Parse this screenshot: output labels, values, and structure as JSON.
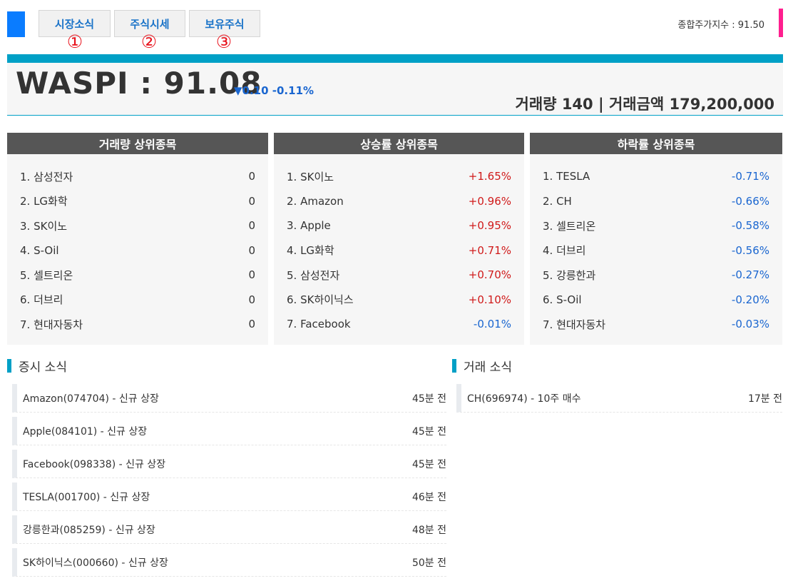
{
  "tabs": [
    {
      "label": "시장소식",
      "num": "①"
    },
    {
      "label": "주식시세",
      "num": "②"
    },
    {
      "label": "보유주식",
      "num": "③"
    }
  ],
  "composite_index": "종합주가지수 : 91.50",
  "summary": {
    "waspi": "WASPI : 91.08",
    "change": "▼0.10 -0.11%",
    "volume_label": "거래량 140 | 거래금액 179,200,000"
  },
  "panels": {
    "volume": {
      "title": "거래량 상위종목",
      "items": [
        {
          "name": "1. 삼성전자",
          "value": "0"
        },
        {
          "name": "2. LG화학",
          "value": "0"
        },
        {
          "name": "3. SK이노",
          "value": "0"
        },
        {
          "name": "4. S-Oil",
          "value": "0"
        },
        {
          "name": "5. 셀트리온",
          "value": "0"
        },
        {
          "name": "6. 더브리",
          "value": "0"
        },
        {
          "name": "7. 현대자동차",
          "value": "0"
        }
      ]
    },
    "rise": {
      "title": "상승률 상위종목",
      "items": [
        {
          "name": "1. SK이노",
          "value": "+1.65%"
        },
        {
          "name": "2. Amazon",
          "value": "+0.96%"
        },
        {
          "name": "3. Apple",
          "value": "+0.95%"
        },
        {
          "name": "4. LG화학",
          "value": "+0.71%"
        },
        {
          "name": "5. 삼성전자",
          "value": "+0.70%"
        },
        {
          "name": "6. SK하이닉스",
          "value": "+0.10%"
        },
        {
          "name": "7. Facebook",
          "value": "-0.01%"
        }
      ]
    },
    "fall": {
      "title": "하락률 상위종목",
      "items": [
        {
          "name": "1. TESLA",
          "value": "-0.71%"
        },
        {
          "name": "2. CH",
          "value": "-0.66%"
        },
        {
          "name": "3. 셀트리온",
          "value": "-0.58%"
        },
        {
          "name": "4. 더브리",
          "value": "-0.56%"
        },
        {
          "name": "5. 강릉한과",
          "value": "-0.27%"
        },
        {
          "name": "6. S-Oil",
          "value": "-0.20%"
        },
        {
          "name": "7. 현대자동차",
          "value": "-0.03%"
        }
      ]
    }
  },
  "market_news": {
    "title": "증시 소식",
    "items": [
      {
        "text": "Amazon(074704) - 신규 상장",
        "time": "45분 전"
      },
      {
        "text": "Apple(084101) - 신규 상장",
        "time": "45분 전"
      },
      {
        "text": "Facebook(098338) - 신규 상장",
        "time": "45분 전"
      },
      {
        "text": "TESLA(001700) - 신규 상장",
        "time": "46분 전"
      },
      {
        "text": "강릉한과(085259) - 신규 상장",
        "time": "48분 전"
      },
      {
        "text": "SK하이닉스(000660) - 신규 상장",
        "time": "50분 전"
      }
    ]
  },
  "trade_news": {
    "title": "거래 소식",
    "items": [
      {
        "text": "CH(696974) - 10주 매수",
        "time": "17분 전"
      }
    ]
  },
  "colors": {
    "accent": "#00a0c6",
    "up": "#d01a1a",
    "down": "#1a66d0",
    "brand": "#0a7cff",
    "pink": "#ff1f8f"
  }
}
